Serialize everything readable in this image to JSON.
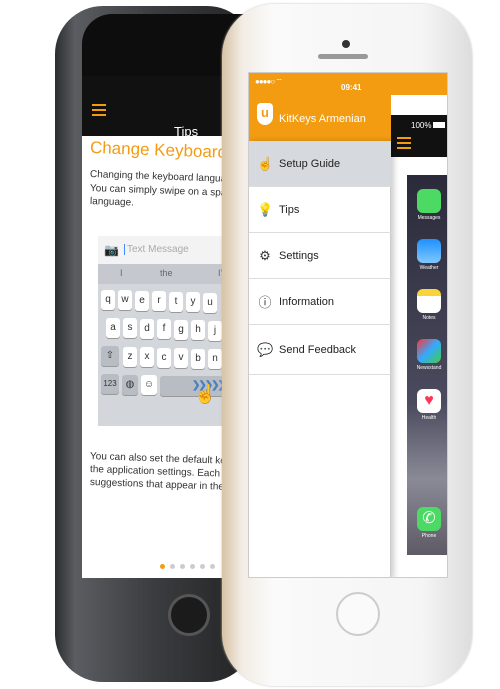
{
  "back_phone": {
    "header_title": "Tips",
    "heading": "Change Keyboard Layout",
    "para1": [
      "Changing the keyboard language is eas",
      "You can simply swipe on a space bar to",
      "language."
    ],
    "message_placeholder": "Text Message",
    "suggestions": [
      "I",
      "the",
      "I'm"
    ],
    "keys_row1": [
      "q",
      "w",
      "e",
      "r",
      "t",
      "y",
      "u"
    ],
    "keys_row2": [
      "a",
      "s",
      "d",
      "f",
      "g",
      "h",
      "j"
    ],
    "keys_row3": [
      "z",
      "x",
      "c",
      "v",
      "b",
      "n"
    ],
    "key_123": "123",
    "para2": [
      "You can also set the default keyboard la",
      "the application settings.  Each languag",
      "suggestions that appear in the top bar."
    ],
    "page_dots": 6,
    "active_dot": 1
  },
  "front_phone": {
    "time": "09:41",
    "battery": "100%",
    "app_title": "KitKeys Armenian",
    "logo_letter": "u",
    "menu": [
      {
        "label": "Setup Guide",
        "icon": "hand-pointer-icon",
        "selected": true
      },
      {
        "label": "Tips",
        "icon": "lightbulb-icon"
      },
      {
        "label": "Settings",
        "icon": "gear-icon"
      },
      {
        "label": "Information",
        "icon": "info-icon"
      },
      {
        "label": "Send Feedback",
        "icon": "chat-bubble-icon"
      }
    ],
    "home_apps": [
      "Messages",
      "Weather",
      "Notes",
      "Newsstand",
      "Health",
      "Phone"
    ]
  },
  "colors": {
    "accent": "#f39c12",
    "header_dark": "#111111",
    "selected_row": "#d6d9dd"
  }
}
